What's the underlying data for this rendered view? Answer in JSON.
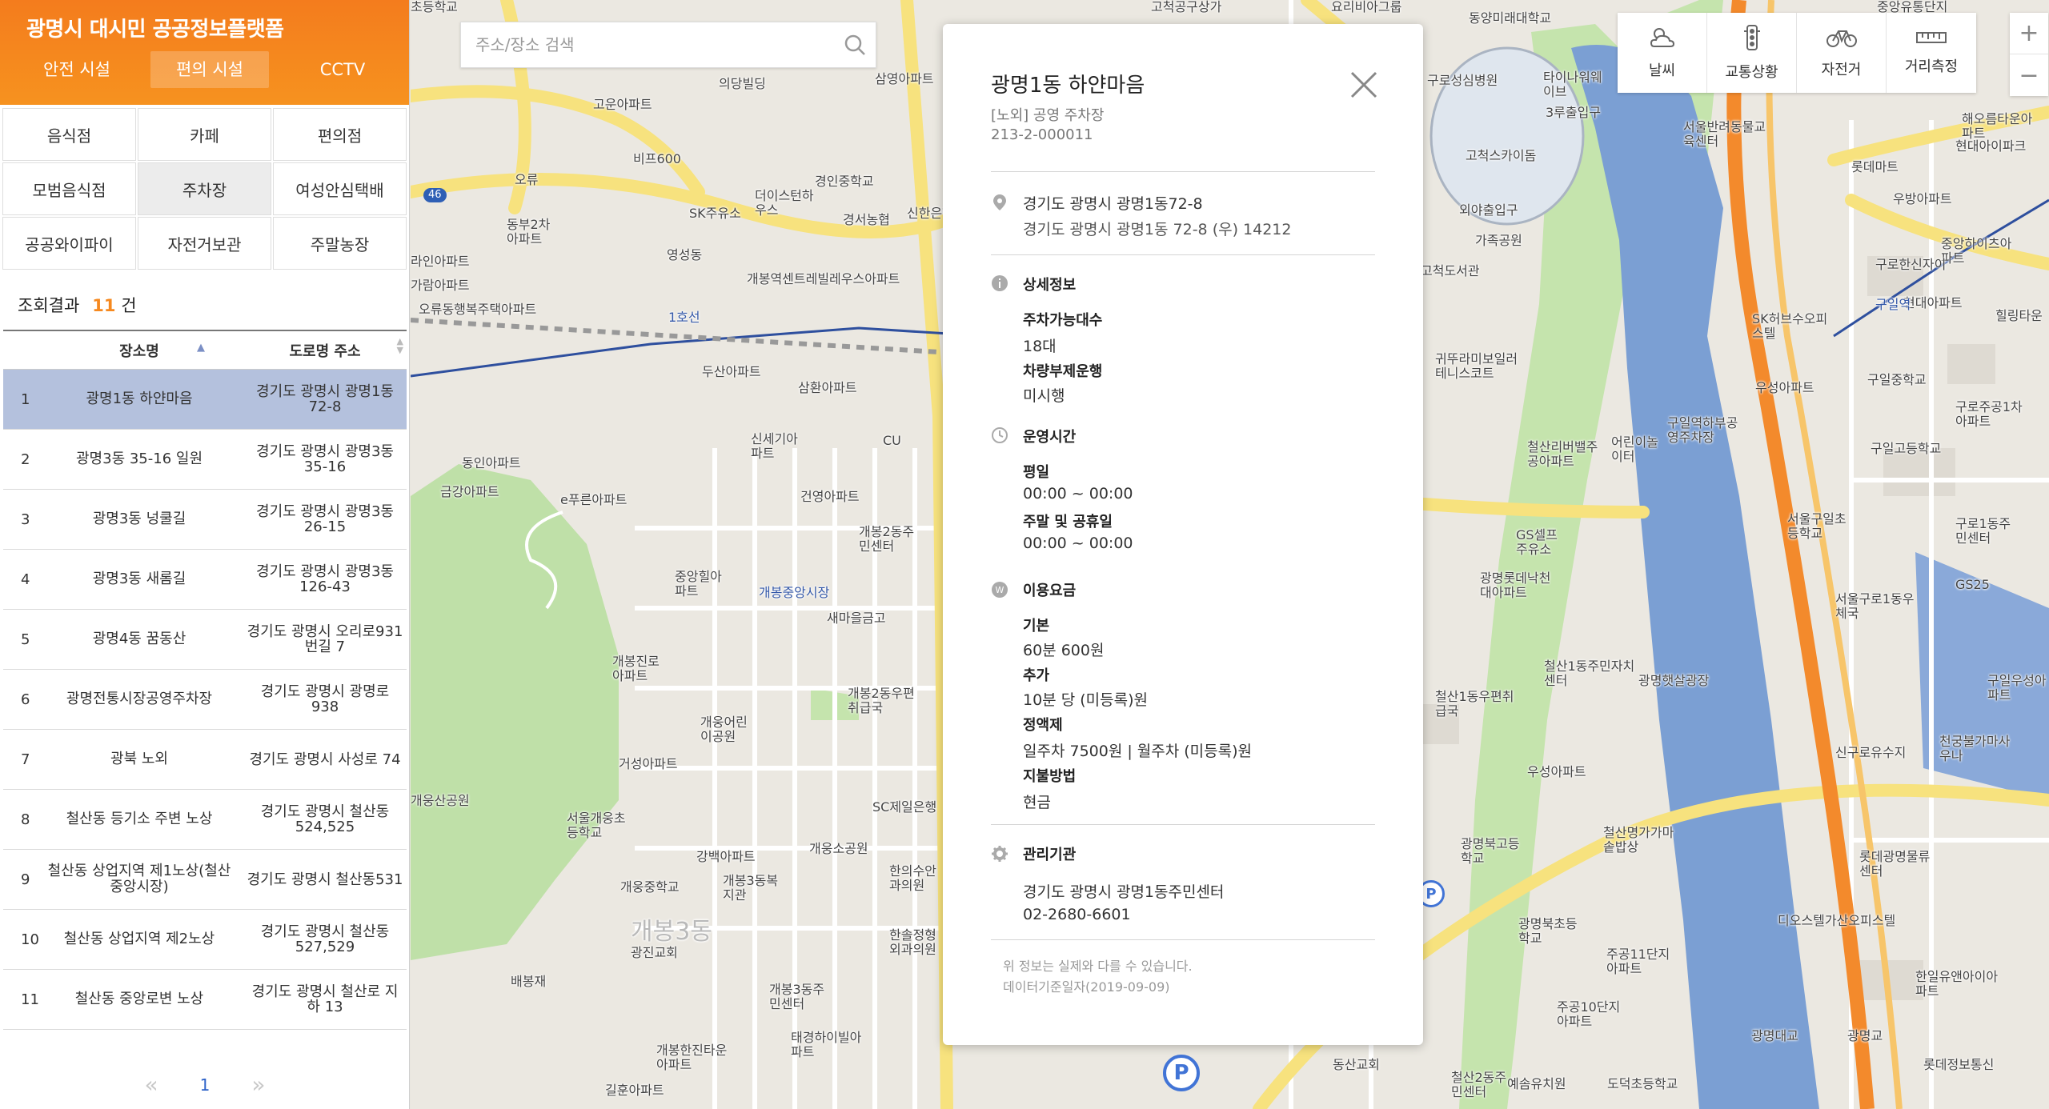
{
  "header": {
    "title": "광명시 대시민 공공정보플랫폼",
    "tabs": [
      "안전 시설",
      "편의 시설",
      "CCTV"
    ]
  },
  "categories": [
    "음식점",
    "카페",
    "편의점",
    "모범음식점",
    "주차장",
    "여성안심택배",
    "공공와이파이",
    "자전거보관",
    "주말농장"
  ],
  "results": {
    "label": "조회결과",
    "count": "11",
    "unit": "건"
  },
  "table": {
    "col_name": "장소명",
    "col_addr": "도로명 주소",
    "rows": [
      {
        "no": "1",
        "name": "광명1동 하얀마음",
        "addr": "경기도 광명시 광명1동72-8"
      },
      {
        "no": "2",
        "name": "광명3동 35-16 일원",
        "addr": "경기도 광명시 광명3동35-16"
      },
      {
        "no": "3",
        "name": "광명3동 넝쿨길",
        "addr": "경기도 광명시 광명3동26-15"
      },
      {
        "no": "4",
        "name": "광명3동 새롬길",
        "addr": "경기도 광명시 광명3동126-43"
      },
      {
        "no": "5",
        "name": "광명4동 꿈동산",
        "addr": "경기도 광명시 오리로931번길 7"
      },
      {
        "no": "6",
        "name": "광명전통시장공영주차장",
        "addr": "경기도 광명시 광명로 938"
      },
      {
        "no": "7",
        "name": "광북 노외",
        "addr": "경기도 광명시 사성로 74"
      },
      {
        "no": "8",
        "name": "철산동 등기소 주변 노상",
        "addr": "경기도 광명시 철산동524,525"
      },
      {
        "no": "9",
        "name": "철산동 상업지역 제1노상(철산중앙시장)",
        "addr": "경기도 광명시 철산동531"
      },
      {
        "no": "10",
        "name": "철산동 상업지역 제2노상",
        "addr": "경기도 광명시 철산동527,529"
      },
      {
        "no": "11",
        "name": "철산동 중앙로변 노상",
        "addr": "경기도 광명시 철산로 지하 13"
      }
    ]
  },
  "pager": {
    "prev": "«",
    "page": "1",
    "next": "»"
  },
  "search": {
    "placeholder": "주소/장소 검색"
  },
  "detail": {
    "title": "광명1동 하얀마음",
    "type": "[노외] 공영 주차장",
    "code": "213-2-000011",
    "addr_jibun": "경기도 광명시 광명1동72-8",
    "addr_road": "경기도 광명시 광명1동 72-8 (우) 14212",
    "info_title": "상세정보",
    "capacity_label": "주차가능대수",
    "capacity": "18대",
    "rotation_label": "차량부제운행",
    "rotation": "미시행",
    "hours_title": "운영시간",
    "weekday_label": "평일",
    "weekday": "00:00 ~ 00:00",
    "weekend_label": "주말 및 공휴일",
    "weekend": "00:00 ~ 00:00",
    "fee_title": "이용요금",
    "base_label": "기본",
    "base": "60분 600원",
    "extra_label": "추가",
    "extra": "10분 당 (미등록)원",
    "pass_label": "정액제",
    "pass": "일주차 7500원 | 월주차 (미등록)원",
    "pay_label": "지불방법",
    "pay": "현금",
    "org_title": "관리기관",
    "org": "경기도 광명시 광명1동주민센터",
    "phone": "02-2680-6601",
    "note1": "위 정보는 실제와 다를 수 있습니다.",
    "note2": "데이터기준일자(2019-09-09)"
  },
  "tools": [
    {
      "label": "날씨",
      "icon": "weather-icon"
    },
    {
      "label": "교통상황",
      "icon": "traffic-light-icon"
    },
    {
      "label": "자전거",
      "icon": "bicycle-icon"
    },
    {
      "label": "거리측정",
      "icon": "ruler-icon"
    }
  ],
  "zoom": {
    "in": "+",
    "out": "−"
  },
  "map_labels": [
    "초등학교",
    "고척공구상가",
    "요리비아그룹",
    "동양미래대학교",
    "중앙유통단지",
    "구로성심병원",
    "타이나워웨이브",
    "3루출입구",
    "서울반려동물교육센터",
    "롯데마트",
    "해오름타운아파트",
    "현대아이파크",
    "고척스카이돔",
    "외야출입구",
    "가족공원",
    "고척도서관",
    "우방아파트",
    "중앙하이츠아파트",
    "구로한신자이",
    "현대아파트",
    "힐링타운",
    "SK허브수오피스텔",
    "구일중학교",
    "구로주공1차아파트",
    "우성아파트",
    "귀뚜라미보일러테니스코트",
    "철산리버밸주공아파트",
    "어린이놀이터",
    "구일역하부공영주차장",
    "구일고등학교",
    "서울구일초등학교",
    "구로1동주민센터",
    "GS25",
    "서울구로1동우체국",
    "광명롯데낙천대아파트",
    "GS셀프주유소",
    "철산1동주민자치센터",
    "광명햇살광장",
    "구일우성아파트",
    "천궁불가마사우나",
    "신구로유수지",
    "철산1동우편취급국",
    "우성아파트",
    "철산명가가마솥밥상",
    "광명북고등학교",
    "광명북초등학교",
    "주공11단지아파트",
    "롯데광명물류센터",
    "디오스텔가산오피스텔",
    "한일유앤아이아파트",
    "주공10단지아파트",
    "광명대교",
    "광명교",
    "도덕초등학교",
    "예솜유치원",
    "철산2동주민센터",
    "롯데정보통신",
    "동산교회",
    "의당빌딩",
    "삼영아파트",
    "고운아파트",
    "비프600",
    "경인중학교",
    "SK주유소",
    "더이스턴하우스",
    "경서농협",
    "신한은행",
    "영성동",
    "개봉역센트레빌레우스아파트",
    "오류동행복주택아파트",
    "오류",
    "동부2차아파트",
    "라인아파트",
    "가람아파트",
    "두산아파트",
    "삼환아파트",
    "신세기아파트",
    "CU",
    "동인아파트",
    "금강아파트",
    "e푸른아파트",
    "건영아파트",
    "개봉2동주민센터",
    "중앙힐아파트",
    "개봉중앙시장",
    "새마을금고",
    "개봉진로아파트",
    "개봉2동우편취급국",
    "개웅어린이공원",
    "거성아파트",
    "SC제일은행",
    "개웅산공원",
    "서울개웅초등학교",
    "개웅중학교",
    "강백아파트",
    "개웅소공원",
    "개봉3동복지관",
    "한의수안과의원",
    "한솔정형외과의원",
    "광진교회",
    "배봉재",
    "개봉3동주민센터",
    "태경하이빌아파트",
    "개봉한진타운아파트",
    "길훈아파트",
    "개봉3동",
    "1호선",
    "구일역",
    "46"
  ]
}
